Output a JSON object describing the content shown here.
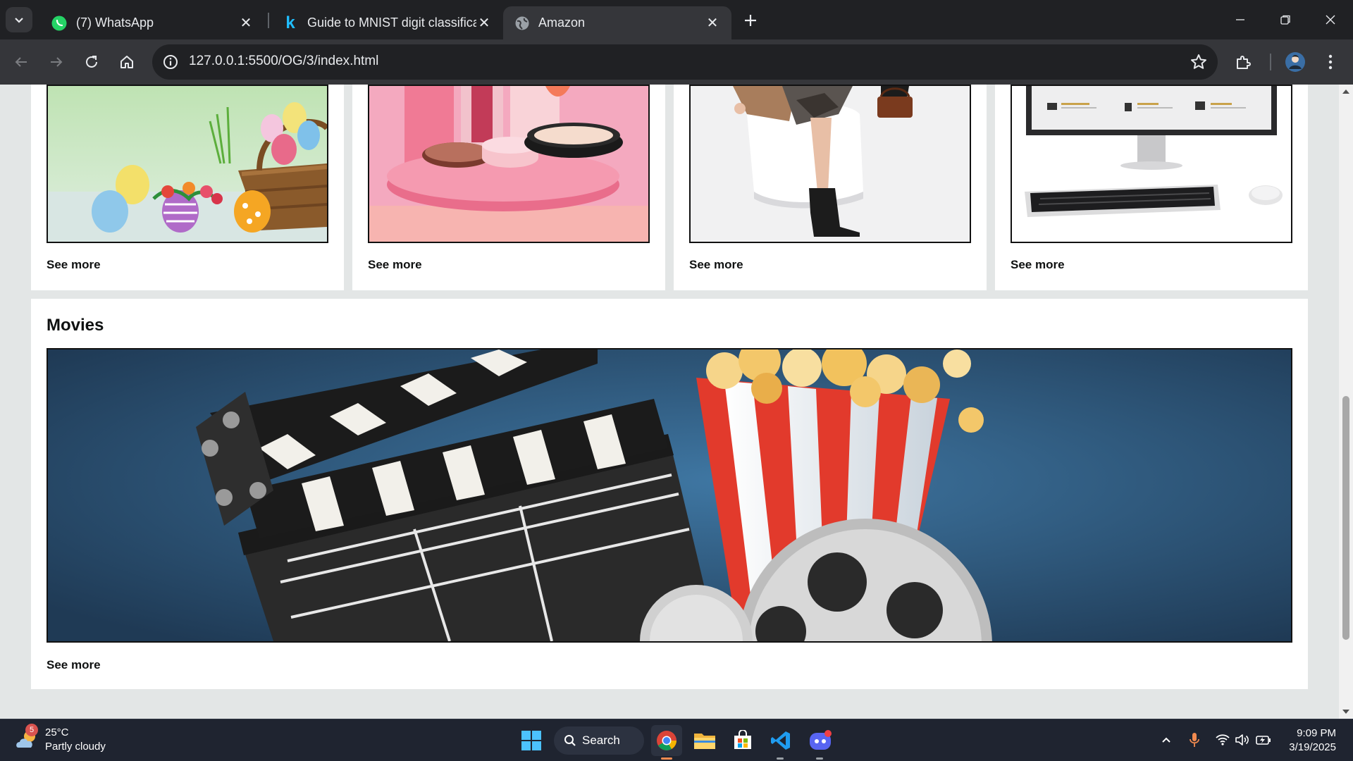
{
  "tabs": [
    {
      "title": "(7) WhatsApp",
      "icon": "whatsapp-icon"
    },
    {
      "title": "Guide to MNIST digit classificati",
      "icon": "kaggle-icon"
    },
    {
      "title": "Amazon",
      "icon": "globe-icon"
    }
  ],
  "address_bar": {
    "url": "127.0.0.1:5500/OG/3/index.html"
  },
  "page": {
    "top_cards": [
      {
        "link": "See more",
        "image": "easter-eggs-basket"
      },
      {
        "link": "See more",
        "image": "pink-cosmetics"
      },
      {
        "link": "See more",
        "image": "fashion-woman-boots"
      },
      {
        "link": "See more",
        "image": "desktop-computer"
      }
    ],
    "movies": {
      "title": "Movies",
      "link": "See more",
      "image": "clapperboard-popcorn"
    }
  },
  "taskbar": {
    "weather": {
      "temp": "25°C",
      "condition": "Partly cloudy",
      "badge": "5"
    },
    "search_label": "Search",
    "time": "9:09 PM",
    "date": "3/19/2025"
  },
  "colors": {
    "chrome_dark": "#202124",
    "chrome_toolbar": "#35363a",
    "page_bg": "#e3e6e6",
    "taskbar": "#1f2430"
  }
}
